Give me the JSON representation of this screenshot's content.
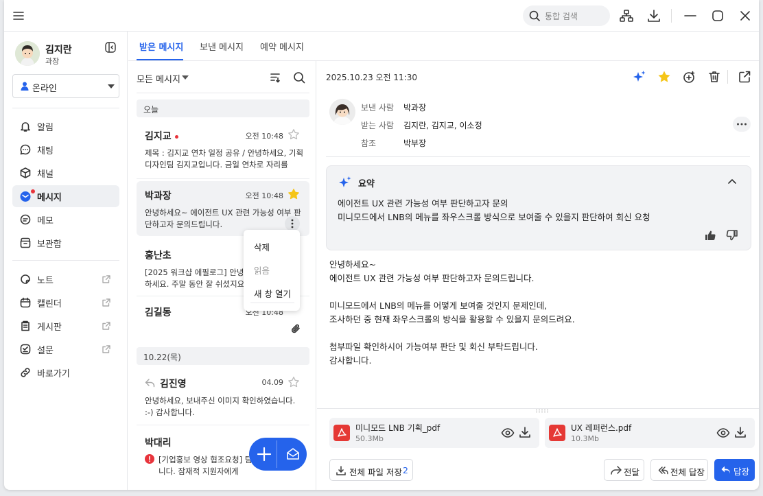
{
  "search": {
    "placeholder": "통합 검색"
  },
  "user": {
    "name": "김지란",
    "role": "과장",
    "status": "온라인"
  },
  "nav": {
    "primary": [
      {
        "label": "알림",
        "icon": "bell-icon"
      },
      {
        "label": "채팅",
        "icon": "chat-icon"
      },
      {
        "label": "채널",
        "icon": "cube-icon"
      },
      {
        "label": "메시지",
        "icon": "mail-icon",
        "active": true
      },
      {
        "label": "메모",
        "icon": "memo-icon"
      },
      {
        "label": "보관함",
        "icon": "archive-icon"
      }
    ],
    "secondary": [
      {
        "label": "노트",
        "icon": "note-icon"
      },
      {
        "label": "캘린더",
        "icon": "calendar-icon"
      },
      {
        "label": "게시판",
        "icon": "board-icon"
      },
      {
        "label": "설문",
        "icon": "survey-icon"
      },
      {
        "label": "바로가기",
        "icon": "link-icon"
      }
    ]
  },
  "tabs": [
    "받은 메시지",
    "보낸 메시지",
    "예약 메시지"
  ],
  "list": {
    "filter": "모든 메시지",
    "groups": {
      "today": "오늘",
      "oct22": "10.22(목)"
    },
    "messages": [
      {
        "sender": "김지교",
        "time": "오전 10:48",
        "preview": "제목 : 김지교 연차 일정 공유 / 안녕하세요, 기획디자인팀 김지교입니다. 금일 연차로 자리를 비..."
      },
      {
        "sender": "박과장",
        "time": "오전 10:48",
        "preview": "안녕하세요~ 에이전트 UX 관련 가능성 여부 판단하고자 문의드립니다."
      },
      {
        "sender": "홍난초",
        "time": "오전 10:48",
        "preview": "[2025 워크샵 에필로그] 안녕하세요. 주말 동안 잘 쉬셨지요~!"
      },
      {
        "sender": "김길동",
        "time": "오전 10:48",
        "preview": ""
      },
      {
        "sender": "김진영",
        "time": "04.09",
        "preview": "안녕하세요, 보내주신 이미지 확인하였습니다. :-) 감사합니다."
      },
      {
        "sender": "박대리",
        "time": "",
        "preview": "[기업홍보 영상 협조요청] 팀입니다. 잠재적 지원자에게"
      }
    ]
  },
  "context_menu": [
    "삭제",
    "읽음",
    "새 창 열기"
  ],
  "detail": {
    "date": "2025.10.23 오전 11:30",
    "from_label": "보낸 사람",
    "from": "박과장",
    "to_label": "받는 사람",
    "to": "김지란, 김지교, 이소정",
    "cc_label": "참조",
    "cc": "박부장",
    "summary_title": "요약",
    "summary_lines": [
      "에이전트 UX 관련 가능성 여부 판단하고자 문의",
      "미니모드에서 LNB의 메뉴를 좌우스크롤 방식으로 보여줄 수 있을지 판단하여 회신 요청"
    ],
    "body": "안녕하세요~\n에이전트 UX 관련 가능성 여부 판단하고자 문의드립니다.\n\n미니모드에서 LNB의 메뉴를 어떻게 보여줄 것인지 문제인데,\n조사하던 중 현재 좌우스크롤의 방식을 활용할 수 있을지 문의드려요.\n\n첨부파일 확인하시어 가능여부 판단 및 회신 부탁드립니다.\n감사합니다.",
    "attachments": [
      {
        "name": "미니모드 LNB 기획_pdf",
        "size": "50.3Mb"
      },
      {
        "name": "UX 레퍼런스.pdf",
        "size": "10.3Mb"
      }
    ],
    "save_all_label": "전체 파일 저장",
    "save_all_count": "2",
    "forward_label": "전달",
    "reply_all_label": "전체 답장",
    "reply_label": "답장"
  },
  "colors": {
    "accent": "#2563eb",
    "star": "#f5c518",
    "unread": "#e8343c",
    "pdf": "#e53935"
  }
}
